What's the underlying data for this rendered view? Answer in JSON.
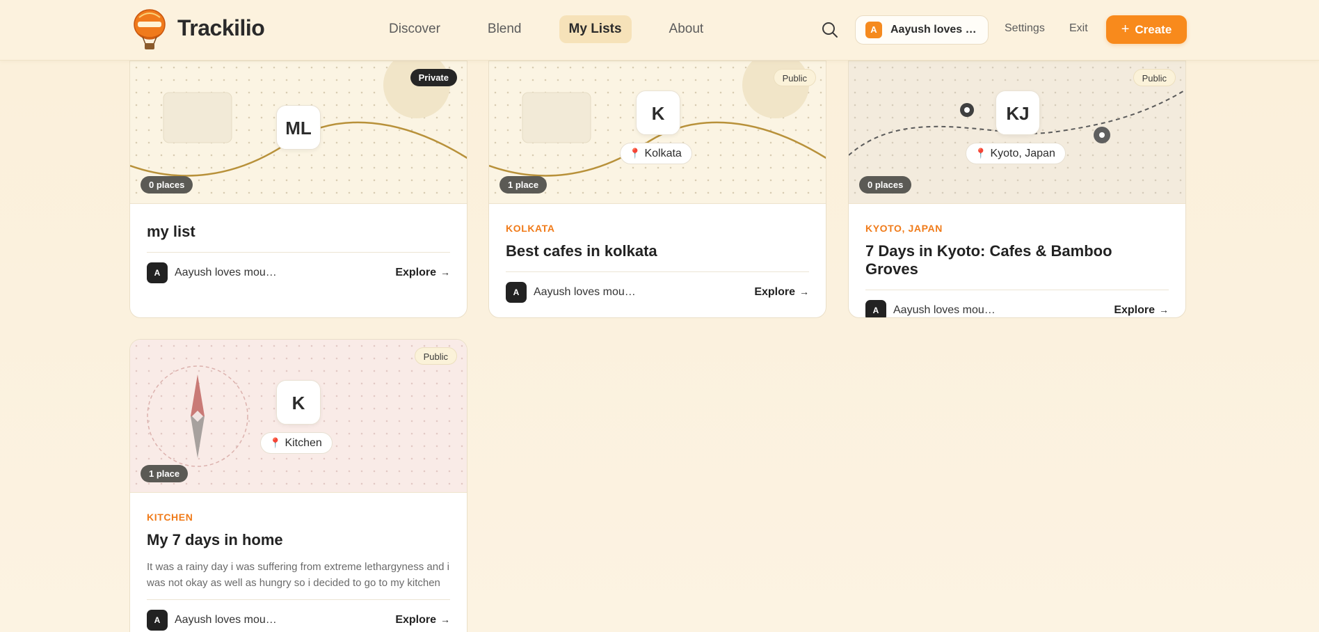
{
  "app": {
    "brand": "Trackilio"
  },
  "nav": {
    "items": [
      {
        "label": "Discover",
        "active": false
      },
      {
        "label": "Blend",
        "active": false
      },
      {
        "label": "My Lists",
        "active": true
      },
      {
        "label": "About",
        "active": false
      }
    ]
  },
  "header": {
    "search_icon": "search-icon",
    "user": {
      "initial": "A",
      "name": "Aayush loves mountains"
    },
    "settings_label": "Settings",
    "exit_label": "Exit",
    "create_label": "Create"
  },
  "colors": {
    "accent": "#f88a1c",
    "background": "#fbf1dc",
    "badge_private": "#262626",
    "pin": "#e0356a"
  },
  "cards": [
    {
      "visibility": "Private",
      "count": "0 places",
      "initials": "ML",
      "location": "",
      "kicker": "",
      "title": "my list",
      "description": "",
      "author_initial": "A",
      "author_name": "Aayush loves mountains",
      "explore_label": "Explore"
    },
    {
      "visibility": "Public",
      "count": "1 place",
      "initials": "K",
      "location": "Kolkata",
      "kicker": "KOLKATA",
      "title": "Best cafes in kolkata",
      "description": "",
      "author_initial": "A",
      "author_name": "Aayush loves mountains",
      "explore_label": "Explore"
    },
    {
      "visibility": "Public",
      "count": "0 places",
      "initials": "KJ",
      "location": "Kyoto, Japan",
      "kicker": "KYOTO, JAPAN",
      "title": "7 Days in Kyoto: Cafes & Bamboo Groves",
      "description": "",
      "author_initial": "A",
      "author_name": "Aayush loves mountains",
      "explore_label": "Explore"
    },
    {
      "visibility": "Public",
      "count": "1 place",
      "initials": "K",
      "location": "Kitchen",
      "kicker": "KITCHEN",
      "title": "My 7 days in home",
      "description": "It was a rainy day i was suffering from extreme lethargyness and i was not okay as well as hungry so i decided to go to my kitchen",
      "author_initial": "A",
      "author_name": "Aayush loves mountains",
      "explore_label": "Explore"
    }
  ]
}
